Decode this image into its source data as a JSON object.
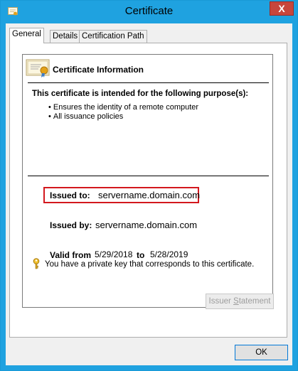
{
  "window": {
    "title": "Certificate"
  },
  "tabs": [
    {
      "label": "General",
      "active": true
    },
    {
      "label": "Details",
      "active": false
    },
    {
      "label": "Certification Path",
      "active": false
    }
  ],
  "info": {
    "heading": "Certificate Information",
    "purpose_heading": "This certificate is intended for the following purpose(s):",
    "purposes": [
      "Ensures the identity of a remote computer",
      "All issuance policies"
    ]
  },
  "fields": {
    "issued_to_label": "Issued to:",
    "issued_to_value": "servername.domain.com",
    "issued_by_label": "Issued by:",
    "issued_by_value": "servername.domain.com",
    "valid_from_label": "Valid from",
    "valid_from_value": "5/29/2018",
    "valid_to_label": "to",
    "valid_to_value": "5/28/2019"
  },
  "key_note": "You have a private key that corresponds to this certificate.",
  "buttons": {
    "issuer_statement_pre": "Issuer ",
    "issuer_statement_s": "S",
    "issuer_statement_post": "tatement",
    "ok": "OK",
    "close": "X"
  },
  "colors": {
    "titlebar": "#1fa2e0",
    "close": "#c7463c",
    "highlight": "#d3181e"
  }
}
